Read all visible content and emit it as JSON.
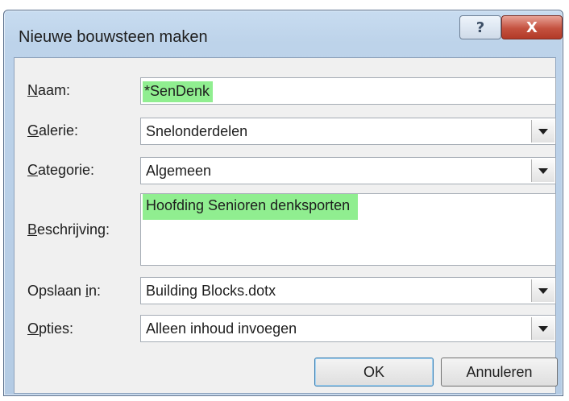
{
  "window": {
    "title": "Nieuwe bouwsteen maken",
    "help_glyph": "?",
    "close_glyph": "X"
  },
  "form": {
    "naam": {
      "label_key": "N",
      "label_rest": "aam:",
      "value": "*SenDenk"
    },
    "galerie": {
      "label_key": "G",
      "label_rest": "alerie:",
      "value": "Snelonderdelen"
    },
    "categorie": {
      "label_key": "C",
      "label_rest": "ategorie:",
      "value": "Algemeen"
    },
    "beschrijving": {
      "label_key": "B",
      "label_rest": "eschrijving:",
      "value": "Hoofding Senioren denksporten"
    },
    "opslaan": {
      "label_pre": "Opslaan ",
      "label_key": "i",
      "label_rest": "n:",
      "value": "Building Blocks.dotx"
    },
    "opties": {
      "label_key": "O",
      "label_rest": "pties:",
      "value": "Alleen inhoud invoegen"
    }
  },
  "buttons": {
    "ok": "OK",
    "cancel": "Annuleren"
  },
  "colors": {
    "highlight": "#90ee90",
    "close_button": "#c4513f"
  },
  "icons": {
    "dropdown": "chevron-down-icon",
    "help": "help-icon",
    "close": "close-icon"
  }
}
